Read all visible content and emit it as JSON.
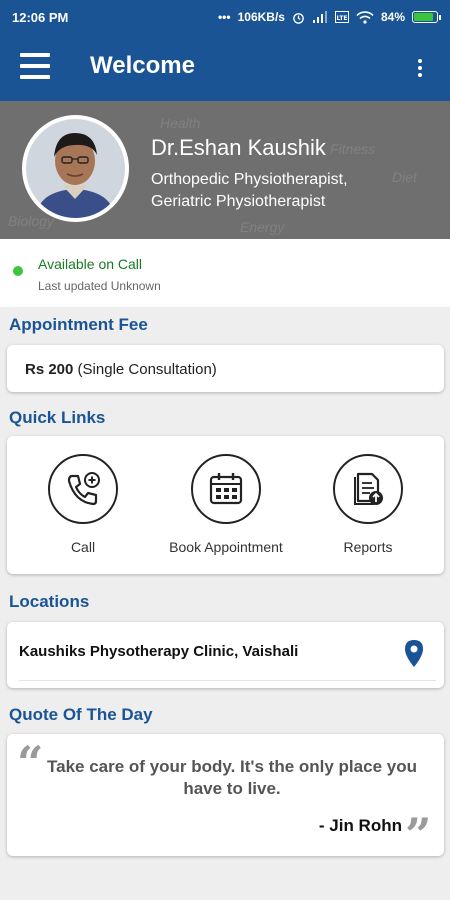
{
  "status_bar": {
    "time": "12:06 PM",
    "dots": "•••",
    "speed": "106KB/s",
    "battery": "84%"
  },
  "app_bar": {
    "title": "Welcome"
  },
  "profile": {
    "name": "Dr.Eshan Kaushik",
    "specialty_line1": "Orthopedic Physiotherapist,",
    "specialty_line2": "Geriatric Physiotherapist"
  },
  "availability": {
    "status": "Available on Call",
    "updated": "Last updated Unknown",
    "status_color": "#3cc63c"
  },
  "fee": {
    "title": "Appointment Fee",
    "amount": "Rs 200",
    "note": "(Single Consultation)"
  },
  "quick_links": {
    "title": "Quick Links",
    "items": [
      {
        "label": "Call",
        "icon": "phone-add-icon"
      },
      {
        "label": "Book Appointment",
        "icon": "calendar-icon"
      },
      {
        "label": "Reports",
        "icon": "report-upload-icon"
      }
    ]
  },
  "locations": {
    "title": "Locations",
    "items": [
      {
        "name": "Kaushiks Physotherapy Clinic, Vaishali"
      }
    ]
  },
  "quote": {
    "title": "Quote Of The Day",
    "text": "Take care of your body. It's the only place you have to live.",
    "author": "- Jin Rohn"
  },
  "colors": {
    "primary": "#1a5495",
    "accent_green": "#3cc63c",
    "background": "#eeeeee"
  }
}
